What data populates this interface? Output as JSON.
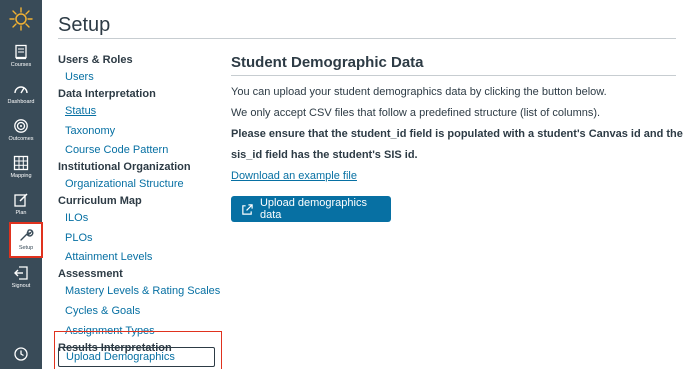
{
  "nav": {
    "items": [
      {
        "key": "courses",
        "label": "Courses",
        "icon": "book-icon"
      },
      {
        "key": "dashboard",
        "label": "Dashboard",
        "icon": "speedometer-icon"
      },
      {
        "key": "outcomes",
        "label": "Outcomes",
        "icon": "target-icon"
      },
      {
        "key": "mapping",
        "label": "Mapping",
        "icon": "grid-icon"
      },
      {
        "key": "plan",
        "label": "Plan",
        "icon": "edit-icon"
      },
      {
        "key": "setup",
        "label": "Setup",
        "icon": "wrench-icon",
        "active": true
      },
      {
        "key": "signout",
        "label": "Signout",
        "icon": "signout-icon"
      }
    ],
    "colors": {
      "rail": "#394b58",
      "highlight": "#e0321e"
    }
  },
  "header": {
    "title": "Setup"
  },
  "settings_nav": {
    "users_roles": "Users & Roles",
    "users": "Users",
    "data_interpretation": "Data Interpretation",
    "status": "Status",
    "taxonomy": "Taxonomy",
    "course_code_pattern": "Course Code Pattern",
    "institutional_organization": "Institutional Organization",
    "organizational_structure": "Organizational Structure",
    "curriculum_map": "Curriculum Map",
    "ilos": "ILOs",
    "plos": "PLOs",
    "attainment_levels": "Attainment Levels",
    "assessment": "Assessment",
    "mastery_levels": "Mastery Levels & Rating Scales",
    "cycles_goals": "Cycles & Goals",
    "assignment_types": "Assignment Types",
    "results_interpretation": "Results Interpretation",
    "upload_demographics": "Upload Demographics"
  },
  "main": {
    "heading": "Student Demographic Data",
    "line1": "You can upload your student demographics data by clicking the button below.",
    "line2": "We only accept CSV files that follow a predefined structure (list of columns).",
    "line3": "Please ensure that the student_id field is populated with a student's Canvas id and the",
    "line4": "sis_id field has the student's SIS id.",
    "example_link": "Download an example file",
    "upload_button": "Upload demographics data",
    "accent": "#0770a3"
  }
}
